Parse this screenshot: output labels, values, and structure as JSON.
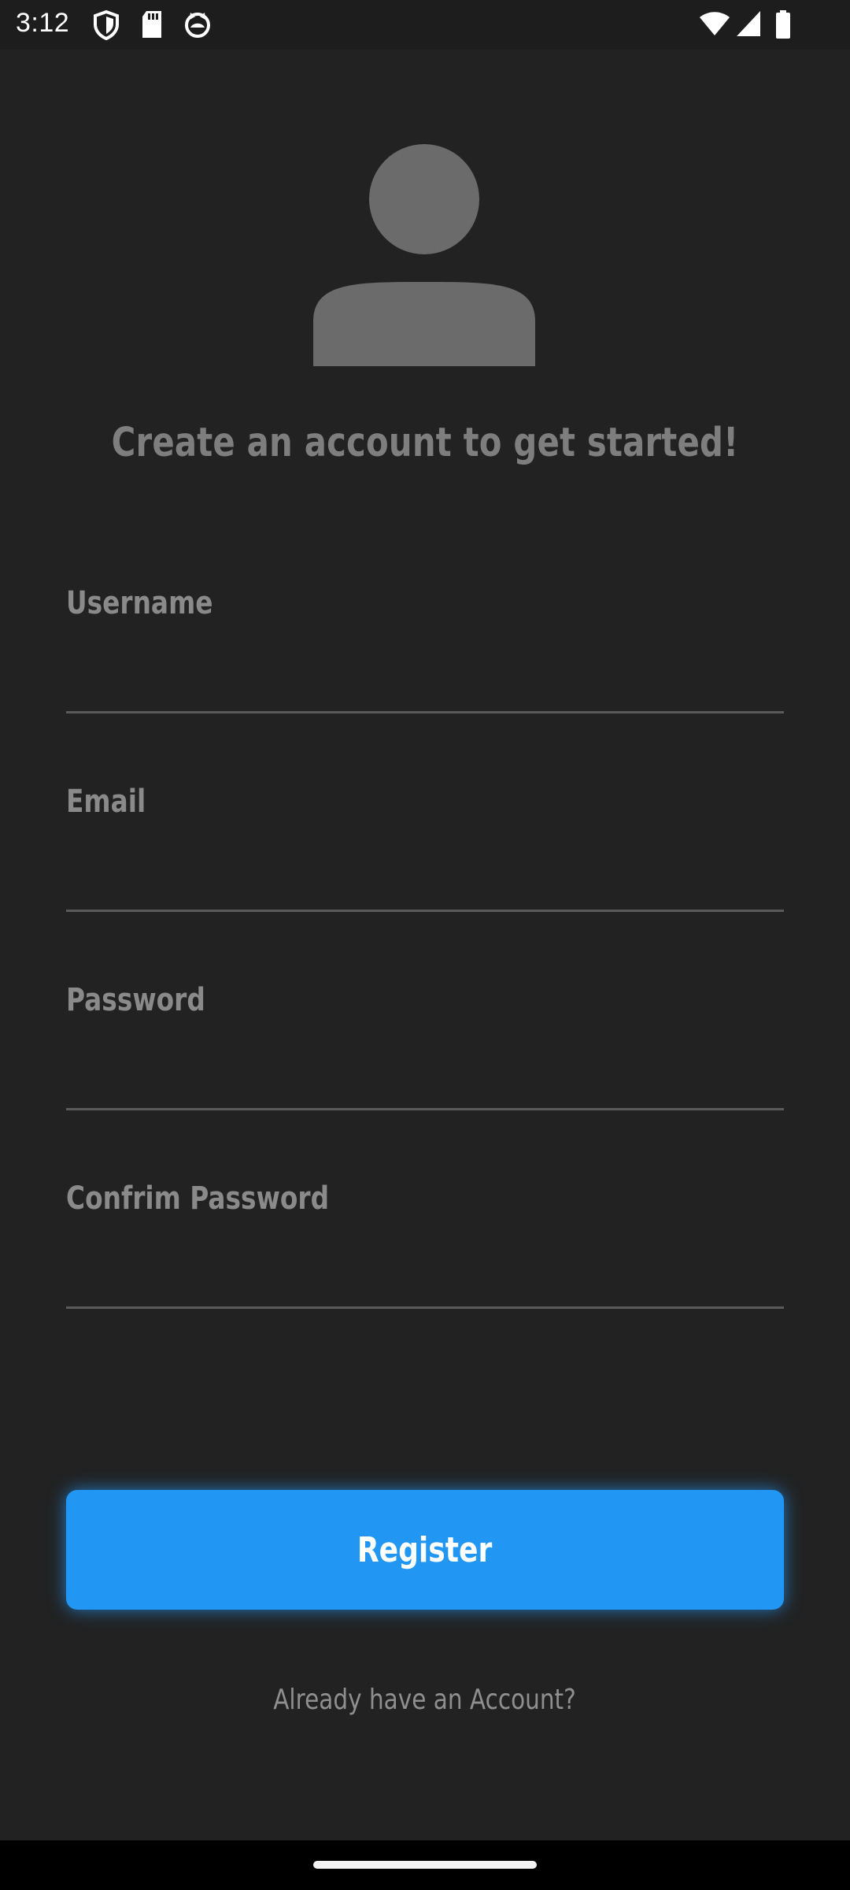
{
  "status_bar": {
    "time": "3:12",
    "left_icons": [
      "shield-icon",
      "sd-card-icon",
      "cat-face-icon"
    ],
    "right_icons": [
      "wifi-icon",
      "cellular-signal-icon",
      "battery-icon"
    ]
  },
  "header": {
    "avatar_icon": "person-icon",
    "headline": "Create an account to get started!"
  },
  "form": {
    "fields": [
      {
        "label": "Username",
        "value": ""
      },
      {
        "label": "Email",
        "value": ""
      },
      {
        "label": "Password",
        "value": ""
      },
      {
        "label": "Confrim Password",
        "value": ""
      }
    ],
    "register_label": "Register",
    "login_link": "Already have an Account?"
  },
  "colors": {
    "background": "#222222",
    "accent": "#2196f3",
    "label_gray": "#8a8a8a"
  }
}
